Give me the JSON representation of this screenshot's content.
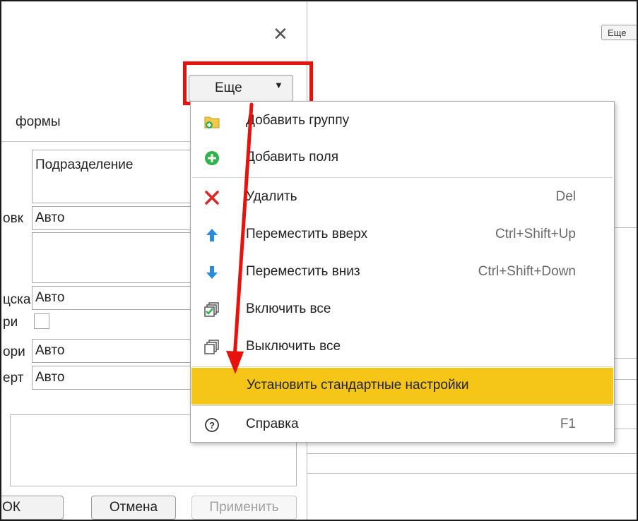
{
  "background": {
    "more_label": "Еще"
  },
  "dialog": {
    "close_glyph": "✕",
    "more_button": {
      "label": "Еще",
      "arrow": "▼"
    },
    "tab_title": "формы",
    "fields": {
      "label1_frag": "овк",
      "label2_frag": "цска",
      "label3_frag": "ри",
      "label4_frag": "ори",
      "label5_frag": "ерт",
      "grouping_value": "Подразделение",
      "value1": "Авто",
      "value2": "Авто",
      "value3": "Авто",
      "value4": "Авто"
    },
    "buttons": {
      "ok": "ОК",
      "cancel": "Отмена",
      "apply": "Применить"
    }
  },
  "menu": {
    "items": [
      {
        "label": "Добавить группу",
        "shortcut": "",
        "icon": "folder-add-icon"
      },
      {
        "label": "Добавить поля",
        "shortcut": "",
        "icon": "plus-circle-icon"
      },
      {
        "label": "Удалить",
        "shortcut": "Del",
        "icon": "delete-x-icon"
      },
      {
        "label": "Переместить вверх",
        "shortcut": "Ctrl+Shift+Up",
        "icon": "arrow-up-icon"
      },
      {
        "label": "Переместить вниз",
        "shortcut": "Ctrl+Shift+Down",
        "icon": "arrow-down-icon"
      },
      {
        "label": "Включить все",
        "shortcut": "",
        "icon": "check-all-icon"
      },
      {
        "label": "Выключить все",
        "shortcut": "",
        "icon": "uncheck-all-icon"
      },
      {
        "label": "Установить стандартные настройки",
        "shortcut": "",
        "icon": ""
      },
      {
        "label": "Справка",
        "shortcut": "F1",
        "icon": "help-icon"
      }
    ],
    "help_glyph": "?"
  },
  "colors": {
    "highlight_item": "#f5c518",
    "annotation_red": "#e8120c",
    "plus_green": "#2fb34a",
    "delete_red": "#e12424",
    "arrow_blue": "#2a8ae0"
  }
}
